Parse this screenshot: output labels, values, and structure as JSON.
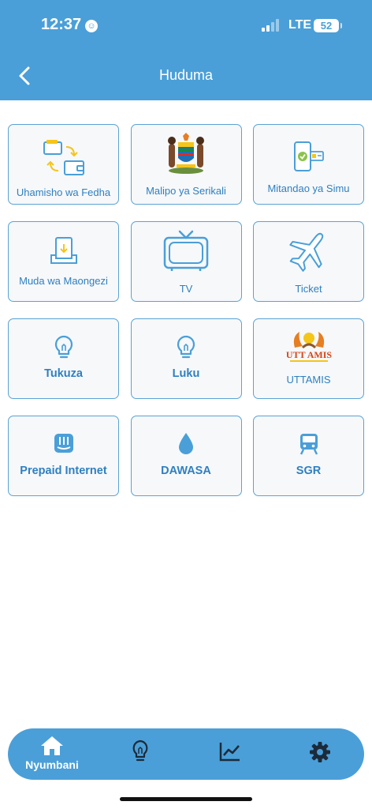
{
  "status_bar": {
    "time": "12:37",
    "network": "LTE",
    "battery": "52"
  },
  "header": {
    "title": "Huduma",
    "back_icon": "chevron-left-icon"
  },
  "services": [
    {
      "label": "Uhamisho wa Fedha",
      "icon": "money-transfer-icon"
    },
    {
      "label": "Malipo ya Serikali",
      "icon": "coat-of-arms-icon"
    },
    {
      "label": "Mitandao ya Simu",
      "icon": "phone-network-icon"
    },
    {
      "label": "Muda wa Maongezi",
      "icon": "airtime-icon"
    },
    {
      "label": "TV",
      "icon": "tv-icon"
    },
    {
      "label": "Ticket",
      "icon": "airplane-icon"
    },
    {
      "label": "Tukuza",
      "icon": "lightbulb-icon"
    },
    {
      "label": "Luku",
      "icon": "lightbulb-icon"
    },
    {
      "label": "UTTAMIS",
      "icon": "uttamis-logo",
      "logo_text": "UTT AMIS"
    },
    {
      "label": "Prepaid Internet",
      "icon": "router-icon"
    },
    {
      "label": "DAWASA",
      "icon": "water-drop-icon"
    },
    {
      "label": "SGR",
      "icon": "train-icon"
    }
  ],
  "bottom_nav": {
    "items": [
      {
        "label": "Nyumbani",
        "icon": "home-icon"
      },
      {
        "label": "",
        "icon": "lightbulb-icon"
      },
      {
        "label": "",
        "icon": "chart-line-icon"
      },
      {
        "label": "",
        "icon": "gear-icon"
      }
    ]
  },
  "colors": {
    "primary": "#4a9fd8",
    "tile_border": "#5aa3d3",
    "tile_text": "#2f7fc0",
    "accent_yellow": "#f5c518",
    "uttamis_orange": "#e4572e"
  }
}
